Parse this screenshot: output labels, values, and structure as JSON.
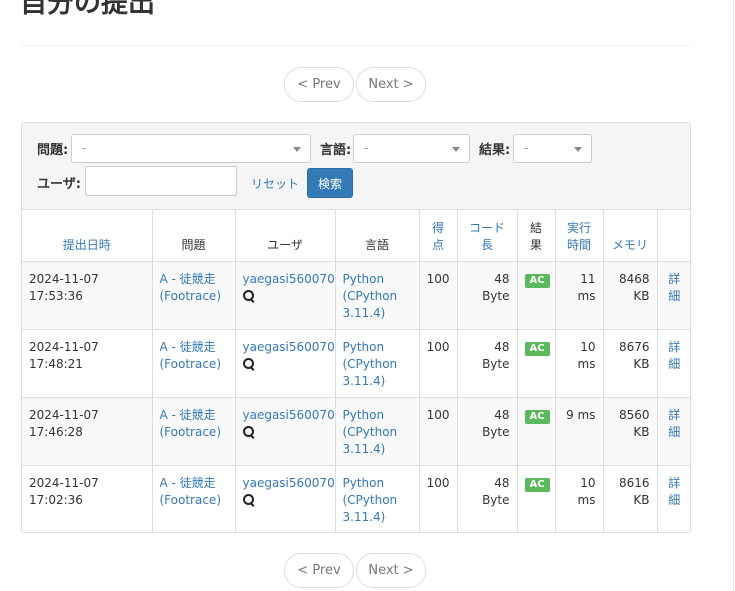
{
  "page": {
    "title": "自分の提出"
  },
  "pagination": {
    "prev_label": "< Prev",
    "next_label": "Next >"
  },
  "filters": {
    "problem_label": "問題:",
    "problem_value": "-",
    "language_label": "言語:",
    "language_value": "-",
    "result_label": "結果:",
    "result_value": "-",
    "user_label": "ユーザ:",
    "user_value": "",
    "reset_label": "リセット",
    "search_label": "検索"
  },
  "table": {
    "headers": {
      "submitted": "提出日時",
      "task": "問題",
      "user": "ユーザ",
      "language": "言語",
      "score_1": "得",
      "score_2": "点",
      "code_1": "コード",
      "code_2": "長",
      "result_1": "結",
      "result_2": "果",
      "time_1": "実行",
      "time_2": "時間",
      "memory": "メモリ",
      "detail": ""
    },
    "rows": [
      {
        "date": "2024-11-07 17:53:36",
        "task_1": "A - 徒競走",
        "task_2": "(Footrace)",
        "user": "yaegasi560070",
        "lang_1": "Python",
        "lang_2": "(CPython",
        "lang_3": "3.11.4)",
        "score": "100",
        "length": "48 Byte",
        "status": "AC",
        "time_1": "11",
        "time_2": "ms",
        "mem_1": "8468",
        "mem_2": "KB",
        "detail_1": "詳",
        "detail_2": "細"
      },
      {
        "date": "2024-11-07 17:48:21",
        "task_1": "A - 徒競走",
        "task_2": "(Footrace)",
        "user": "yaegasi560070",
        "lang_1": "Python",
        "lang_2": "(CPython",
        "lang_3": "3.11.4)",
        "score": "100",
        "length": "48 Byte",
        "status": "AC",
        "time_1": "10",
        "time_2": "ms",
        "mem_1": "8676",
        "mem_2": "KB",
        "detail_1": "詳",
        "detail_2": "細"
      },
      {
        "date": "2024-11-07 17:46:28",
        "task_1": "A - 徒競走",
        "task_2": "(Footrace)",
        "user": "yaegasi560070",
        "lang_1": "Python",
        "lang_2": "(CPython",
        "lang_3": "3.11.4)",
        "score": "100",
        "length": "48 Byte",
        "status": "AC",
        "time_1": "9 ms",
        "time_2": "",
        "mem_1": "8560",
        "mem_2": "KB",
        "detail_1": "詳",
        "detail_2": "細"
      },
      {
        "date": "2024-11-07 17:02:36",
        "task_1": "A - 徒競走",
        "task_2": "(Footrace)",
        "user": "yaegasi560070",
        "lang_1": "Python",
        "lang_2": "(CPython",
        "lang_3": "3.11.4)",
        "score": "100",
        "length": "48 Byte",
        "status": "AC",
        "time_1": "10",
        "time_2": "ms",
        "mem_1": "8616",
        "mem_2": "KB",
        "detail_1": "詳",
        "detail_2": "細"
      }
    ]
  },
  "icons": {
    "user_search": "magnifier-icon",
    "select_caret": "caret-down-icon"
  },
  "colors": {
    "link": "#337ab7",
    "ac_badge": "#5cb85c",
    "search_button": "#337ab7"
  }
}
